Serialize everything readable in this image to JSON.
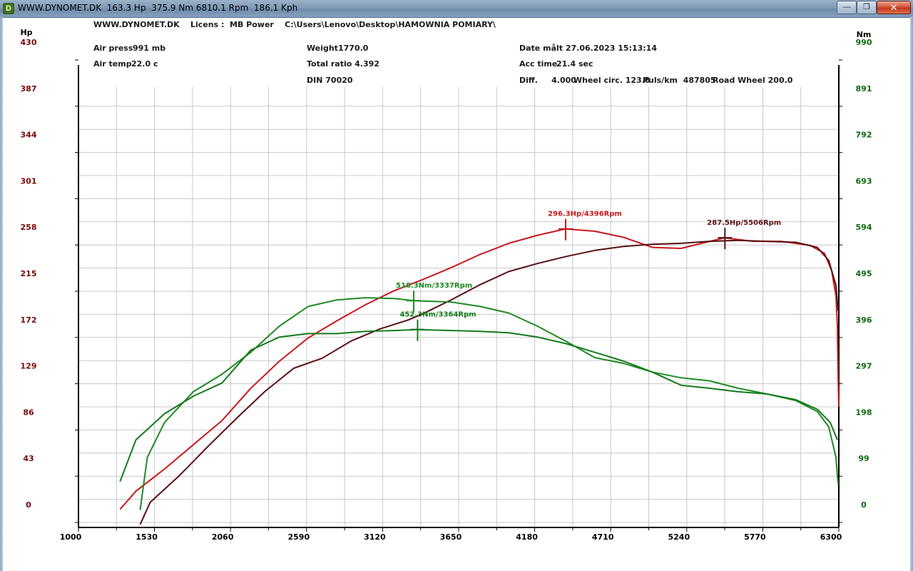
{
  "window": {
    "title": "WWW.DYNOMET.DK  163.3 Hp  375.9 Nm 6810.1 Rpm  186.1 Kph",
    "icon_letter": "D",
    "buttons": {
      "minimize": "—",
      "maximize": "❐",
      "close": "✕"
    }
  },
  "header": {
    "line1": "WWW.DYNOMET.DK    Licens :  MB Power    C:\\Users\\Lenovo\\Desktop\\HAMOWNIA POMIARY\\",
    "air_press_label": "Air press",
    "air_press_value": "991 mb",
    "air_temp_label": "Air temp",
    "air_temp_value": "22.0 c",
    "weight_label": "Weight",
    "weight_value": "1770.0",
    "total_ratio": "Total ratio 4.392",
    "din": "DIN 70020",
    "date": "Date målt 27.06.2023 15:13:14",
    "acc_time_label": "Acc time",
    "acc_time_value": "21.4 sec",
    "diff": "Diff.     4.000",
    "wheel_circ": "Wheel circ. 123.0",
    "puls": "Puls/km  487805",
    "road_wheel": "Road Wheel 200.0"
  },
  "chart_data": {
    "type": "line",
    "xlabel": "",
    "ylabel_left": "Hp",
    "ylabel_right": "Nm",
    "xlim": [
      1000,
      6300
    ],
    "ylim_left": [
      0,
      430
    ],
    "ylim_right": [
      0,
      990
    ],
    "x_ticks": [
      "1000",
      "1530",
      "2060",
      "2590",
      "3120",
      "3650",
      "4180",
      "4710",
      "5240",
      "5770",
      "6300"
    ],
    "y_left_ticks": [
      "0",
      "43",
      "86",
      "129",
      "172",
      "215",
      "258",
      "301",
      "344",
      "387",
      "430"
    ],
    "y_right_ticks": [
      "0",
      "99",
      "198",
      "297",
      "396",
      "495",
      "594",
      "693",
      "792",
      "891",
      "990"
    ],
    "grid": true,
    "colors": {
      "power_tuned": "#c8191e",
      "power_stock": "#5a0f12",
      "torque_tuned": "#1f8a22",
      "torque_stock": "#157a1c",
      "left_axis": "#7a0a0a",
      "right_axis": "#0d6b0d",
      "grid": "#c8c8c8"
    },
    "series": [
      {
        "axis": "left",
        "color_key": "power_tuned",
        "points": [
          [
            1290,
            18
          ],
          [
            1400,
            36
          ],
          [
            1600,
            58
          ],
          [
            1800,
            82
          ],
          [
            2000,
            106
          ],
          [
            2200,
            138
          ],
          [
            2400,
            165
          ],
          [
            2600,
            188
          ],
          [
            2800,
            205
          ],
          [
            3000,
            221
          ],
          [
            3200,
            235
          ],
          [
            3400,
            246
          ],
          [
            3600,
            258
          ],
          [
            3800,
            271
          ],
          [
            4000,
            282
          ],
          [
            4200,
            290
          ],
          [
            4396,
            296.3
          ],
          [
            4600,
            294
          ],
          [
            4800,
            288
          ],
          [
            5000,
            278
          ],
          [
            5200,
            277
          ],
          [
            5400,
            284
          ],
          [
            5506,
            287.5
          ],
          [
            5700,
            284
          ],
          [
            5900,
            284
          ],
          [
            6100,
            280
          ],
          [
            6200,
            272
          ],
          [
            6250,
            255
          ],
          [
            6280,
            230
          ],
          [
            6290,
            200
          ],
          [
            6295,
            150
          ],
          [
            6300,
            120
          ]
        ]
      },
      {
        "axis": "left",
        "color_key": "power_stock",
        "points": [
          [
            1430,
            3
          ],
          [
            1500,
            25
          ],
          [
            1700,
            51
          ],
          [
            1900,
            80
          ],
          [
            2100,
            108
          ],
          [
            2300,
            135
          ],
          [
            2500,
            158
          ],
          [
            2700,
            168
          ],
          [
            2900,
            185
          ],
          [
            3100,
            197
          ],
          [
            3300,
            206
          ],
          [
            3400,
            212
          ],
          [
            3600,
            226
          ],
          [
            3800,
            241
          ],
          [
            4000,
            254
          ],
          [
            4200,
            262
          ],
          [
            4400,
            269
          ],
          [
            4600,
            275
          ],
          [
            4800,
            279
          ],
          [
            5000,
            281
          ],
          [
            5200,
            282
          ],
          [
            5400,
            284
          ],
          [
            5600,
            285
          ],
          [
            5800,
            284
          ],
          [
            6000,
            283
          ],
          [
            6150,
            278
          ],
          [
            6230,
            265
          ],
          [
            6280,
            240
          ],
          [
            6295,
            215
          ]
        ]
      },
      {
        "axis": "right",
        "color_key": "torque_tuned",
        "points": [
          [
            1430,
            40
          ],
          [
            1480,
            160
          ],
          [
            1600,
            240
          ],
          [
            1800,
            310
          ],
          [
            2000,
            350
          ],
          [
            2200,
            400
          ],
          [
            2400,
            460
          ],
          [
            2600,
            505
          ],
          [
            2800,
            520
          ],
          [
            3000,
            525
          ],
          [
            3200,
            523
          ],
          [
            3337,
            518.3
          ],
          [
            3600,
            515
          ],
          [
            3800,
            505
          ],
          [
            4000,
            490
          ],
          [
            4200,
            460
          ],
          [
            4400,
            425
          ],
          [
            4600,
            388
          ],
          [
            4800,
            375
          ],
          [
            5000,
            355
          ],
          [
            5200,
            342
          ],
          [
            5400,
            335
          ],
          [
            5600,
            318
          ],
          [
            5800,
            305
          ],
          [
            6000,
            290
          ],
          [
            6150,
            265
          ],
          [
            6230,
            230
          ],
          [
            6280,
            160
          ],
          [
            6295,
            100
          ]
        ]
      },
      {
        "axis": "right",
        "color_key": "torque_stock",
        "points": [
          [
            1290,
            105
          ],
          [
            1400,
            200
          ],
          [
            1600,
            260
          ],
          [
            1800,
            300
          ],
          [
            2000,
            330
          ],
          [
            2200,
            405
          ],
          [
            2400,
            435
          ],
          [
            2600,
            443
          ],
          [
            2800,
            443
          ],
          [
            3000,
            448
          ],
          [
            3200,
            450
          ],
          [
            3364,
            452.3
          ],
          [
            3600,
            450
          ],
          [
            3800,
            448
          ],
          [
            4000,
            445
          ],
          [
            4200,
            435
          ],
          [
            4400,
            420
          ],
          [
            4600,
            400
          ],
          [
            4800,
            380
          ],
          [
            5000,
            355
          ],
          [
            5200,
            325
          ],
          [
            5400,
            318
          ],
          [
            5600,
            310
          ],
          [
            5800,
            305
          ],
          [
            6000,
            292
          ],
          [
            6150,
            270
          ],
          [
            6240,
            240
          ],
          [
            6290,
            200
          ]
        ]
      }
    ],
    "annotations": [
      {
        "text": "296.3Hp/4396Rpm",
        "axis": "left",
        "x": 4396,
        "y": 296.3,
        "color_key": "power_tuned"
      },
      {
        "text": "287.5Hp/5506Rpm",
        "axis": "left",
        "x": 5506,
        "y": 287.5,
        "color_key": "power_stock"
      },
      {
        "text": "518.3Nm/3337Rpm",
        "axis": "right",
        "x": 3337,
        "y": 518.3,
        "color_key": "torque_tuned"
      },
      {
        "text": "452.3Nm/3364Rpm",
        "axis": "right",
        "x": 3364,
        "y": 452.3,
        "color_key": "torque_stock"
      }
    ]
  }
}
